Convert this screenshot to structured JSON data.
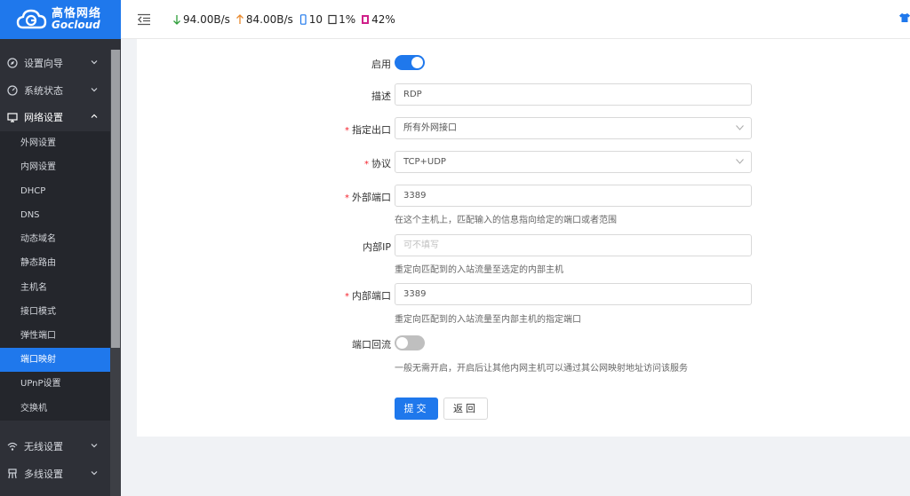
{
  "brand": {
    "cn": "高恪网络",
    "en": "Gocloud"
  },
  "topbar": {
    "download": "94.00B/s",
    "upload": "84.00B/s",
    "devices": "10",
    "cpu": "1%",
    "memory": "42%"
  },
  "sidebar": {
    "groups_top": [
      {
        "label": "设置向导",
        "icon": "compass-icon"
      },
      {
        "label": "系统状态",
        "icon": "dashboard-icon"
      },
      {
        "label": "网络设置",
        "icon": "monitor-icon"
      }
    ],
    "sub_items": [
      "外网设置",
      "内网设置",
      "DHCP",
      "DNS",
      "动态域名",
      "静态路由",
      "主机名",
      "接口模式",
      "弹性端口",
      "端口映射",
      "UPnP设置",
      "交换机"
    ],
    "active_sub": "端口映射",
    "groups_bottom": [
      {
        "label": "无线设置",
        "icon": "wifi-icon"
      },
      {
        "label": "多线设置",
        "icon": "multiline-icon"
      }
    ]
  },
  "form": {
    "enable_label": "启用",
    "enable_on": true,
    "desc_label": "描述",
    "desc_value": "RDP",
    "outlet_label": "指定出口",
    "outlet_value": "所有外网接口",
    "protocol_label": "协议",
    "protocol_value": "TCP+UDP",
    "ext_port_label": "外部端口",
    "ext_port_value": "3389",
    "ext_port_hint": "在这个主机上，匹配输入的信息指向给定的端口或者范围",
    "int_ip_label": "内部IP",
    "int_ip_placeholder": "可不填写",
    "int_ip_hint": "重定向匹配到的入站流量至选定的内部主机",
    "int_port_label": "内部端口",
    "int_port_value": "3389",
    "int_port_hint": "重定向匹配到的入站流量至内部主机的指定端口",
    "loopback_label": "端口回流",
    "loopback_on": false,
    "loopback_hint": "一般无需开启，开启后让其他内网主机可以通过其公网映射地址访问该服务",
    "submit_label": "提交",
    "back_label": "返回"
  },
  "colors": {
    "accent": "#1f78ec",
    "sidebar": "#2e3037",
    "required": "#f5222d"
  }
}
